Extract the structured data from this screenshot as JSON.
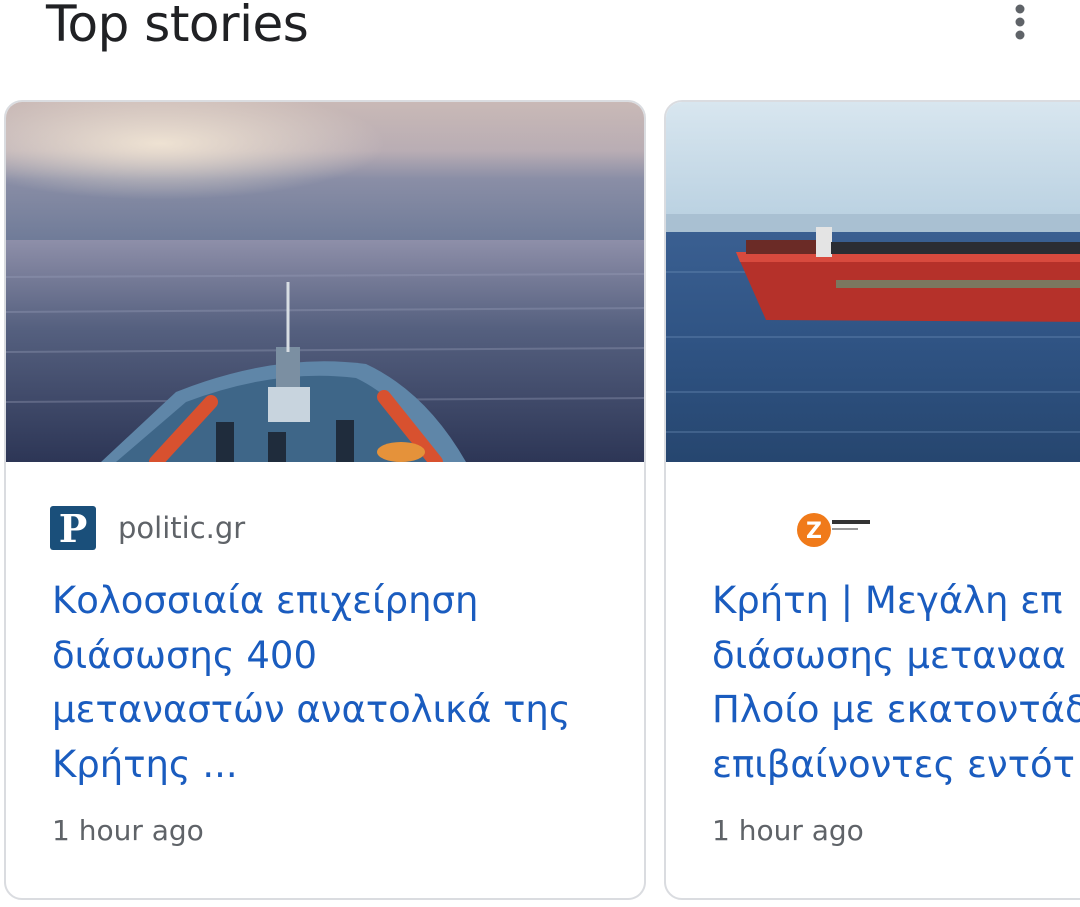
{
  "header": {
    "title": "Top stories",
    "more_icon": "more-vert-icon"
  },
  "stories": [
    {
      "source": "politic.gr",
      "logo_letter": "P",
      "logo_color": "#1a4f7a",
      "headline_lines": [
        "Κολοσσιαία επιχείρηση",
        "διάσωσης 400",
        "μεταναστών ανατολικά της",
        "Κρήτης ..."
      ],
      "time": "1 hour ago",
      "image": "ship-bow-sunset-sea"
    },
    {
      "source": "",
      "logo_letter": "Z",
      "logo_color": "#f07a1a",
      "headline_lines": [
        "Κρήτη | Μεγάλη επ",
        "διάσωσης μεταναα",
        "Πλοίο με εκατοντάδ",
        "επιβαίνοντες εντότ"
      ],
      "time": "1 hour ago",
      "image": "red-cargo-ship-at-sea"
    }
  ],
  "colors": {
    "headline": "#1a5cbf",
    "meta_text": "#5f6368",
    "card_border": "#dadce0"
  }
}
